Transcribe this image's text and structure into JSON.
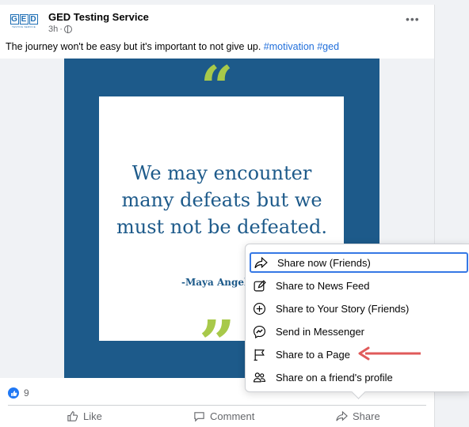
{
  "post": {
    "author": "GED Testing Service",
    "logo_letters": [
      "G",
      "E",
      "D"
    ],
    "logo_subtext": "TESTING SERVICE",
    "time": "3h",
    "time_separator": "·",
    "more_label": "•••",
    "caption_text": "The journey won't be easy but it's important to not give up. ",
    "hashtags": [
      "#motivation",
      "#ged"
    ],
    "quote_open": "“",
    "quote_close": "”",
    "quote_lines": [
      "We may encounter",
      "many defeats but we",
      "must not be defeated."
    ],
    "quote_author": "-Maya Angel",
    "reaction_count": "9"
  },
  "actions": {
    "like": "Like",
    "comment": "Comment",
    "share": "Share"
  },
  "share_menu": {
    "items": [
      {
        "label": "Share now (Friends)",
        "icon": "share-arrow-icon"
      },
      {
        "label": "Share to News Feed",
        "icon": "edit-post-icon"
      },
      {
        "label": "Share to Your Story (Friends)",
        "icon": "plus-circle-icon"
      },
      {
        "label": "Send in Messenger",
        "icon": "messenger-icon"
      },
      {
        "label": "Share to a Page",
        "icon": "flag-icon"
      },
      {
        "label": "Share on a friend's profile",
        "icon": "friends-icon"
      }
    ]
  },
  "colors": {
    "accent": "#3578e5",
    "quote_blue": "#1d5a8a",
    "quote_green": "#a8c94a",
    "annotation_arrow": "#e05a5a",
    "link": "#216fdb"
  }
}
